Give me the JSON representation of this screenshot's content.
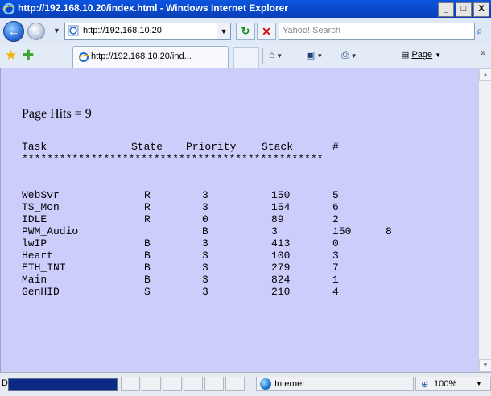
{
  "window": {
    "title": "http://192.168.10.20/index.html - Windows Internet Explorer",
    "min": "_",
    "max": "□",
    "close": "X"
  },
  "nav": {
    "back_label": "←",
    "forward_label": "→",
    "address_value": "http://192.168.10.20",
    "refresh_label": "↻",
    "stop_label": "✕",
    "search_placeholder": "Yahoo! Search",
    "search_label": "⌕"
  },
  "tabs": {
    "active_label": "http://192.168.10.20/ind..."
  },
  "commands": {
    "page_label": "Page",
    "more_label": "»"
  },
  "page": {
    "hits": "Page Hits = 9",
    "headers": [
      "Task",
      "State",
      "Priority",
      "Stack",
      "#"
    ],
    "separator": "************************************************",
    "rows": [
      [
        "WebSvr",
        "R",
        "3",
        "150",
        "5",
        ""
      ],
      [
        "TS_Mon",
        "R",
        "3",
        "154",
        "6",
        ""
      ],
      [
        "IDLE",
        "R",
        "0",
        "89",
        "2",
        ""
      ],
      [
        "PWM_Audio",
        "",
        "B",
        "3",
        "150",
        "8"
      ],
      [
        "lwIP",
        "B",
        "3",
        "413",
        "0",
        ""
      ],
      [
        "Heart",
        "B",
        "3",
        "100",
        "3",
        ""
      ],
      [
        "ETH_INT",
        "B",
        "3",
        "279",
        "7",
        ""
      ],
      [
        "Main",
        "B",
        "3",
        "824",
        "1",
        ""
      ],
      [
        "GenHID",
        "S",
        "3",
        "210",
        "4",
        ""
      ]
    ]
  },
  "status": {
    "text": "D",
    "zone": "Internet",
    "zoom": "100%"
  }
}
